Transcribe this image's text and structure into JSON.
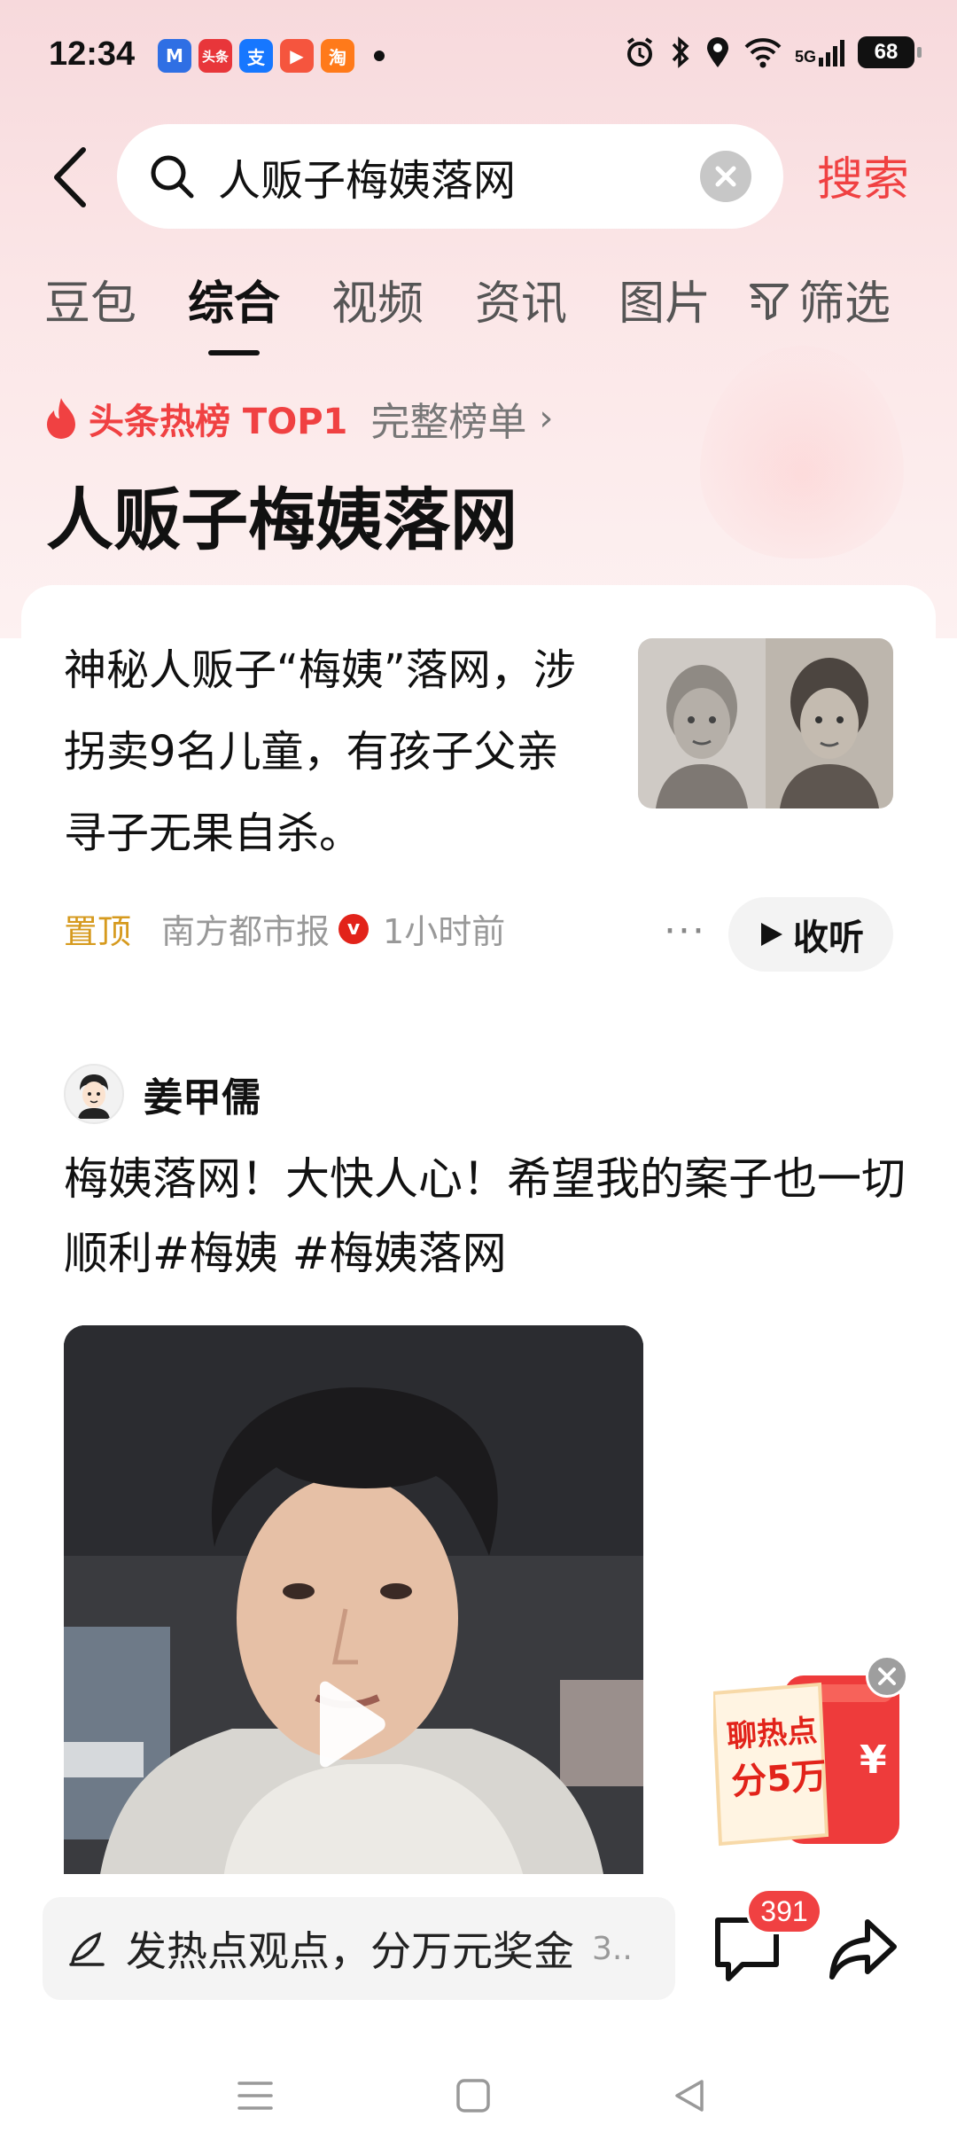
{
  "status_bar": {
    "time": "12:34",
    "apps": [
      {
        "name": "maps-app-icon",
        "glyph": "M",
        "color": "#2f6fe4"
      },
      {
        "name": "toutiao-app-icon",
        "glyph": "头条",
        "color": "#e8363a"
      },
      {
        "name": "alipay-app-icon",
        "glyph": "支",
        "color": "#1677ff"
      },
      {
        "name": "video-app-icon",
        "glyph": "▶",
        "color": "#f5553e"
      },
      {
        "name": "taobao-app-icon",
        "glyph": "淘",
        "color": "#ff7a1a"
      }
    ],
    "network": "5G",
    "battery": "68"
  },
  "search": {
    "query": "人贩子梅姨落网",
    "action_label": "搜索"
  },
  "tabs": [
    {
      "label": "豆包",
      "active": false
    },
    {
      "label": "综合",
      "active": true
    },
    {
      "label": "视频",
      "active": false
    },
    {
      "label": "资讯",
      "active": false
    },
    {
      "label": "图片",
      "active": false
    }
  ],
  "filter_label": "筛选",
  "hot": {
    "badge": "头条热榜 TOP1",
    "more": "完整榜单"
  },
  "page_title": "人贩子梅姨落网",
  "news": {
    "text": "神秘人贩子“梅姨”落网，涉拐卖9名儿童，有孩子父亲寻子无果自杀。",
    "pinned": "置顶",
    "source": "南方都市报",
    "verified": "v",
    "time_ago": "1小时前",
    "listen_label": "收听"
  },
  "post": {
    "author": "姜甲儒",
    "text": "梅姨落网！大快人心！希望我的案子也一切顺利#梅姨 #梅姨落网"
  },
  "promo": {
    "line1": "聊热点",
    "line2": "分5万",
    "currency": "¥"
  },
  "bottom": {
    "comment_placeholder": "发热点观点，分万元奖金",
    "comment_hint": "3..",
    "comment_count": "391"
  },
  "colors": {
    "accent": "#f04142",
    "pinned": "#d69a1e",
    "muted": "#999999"
  }
}
